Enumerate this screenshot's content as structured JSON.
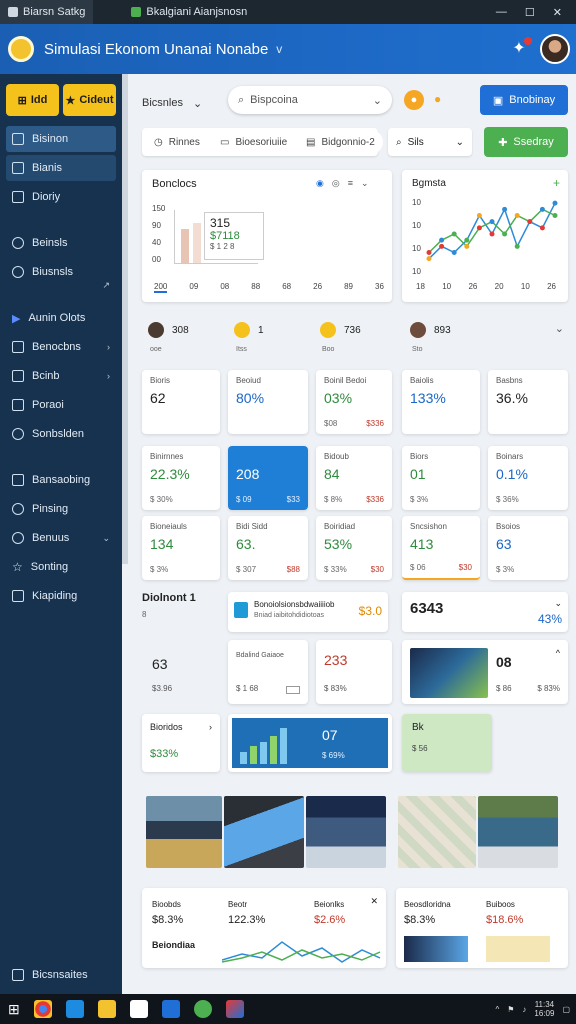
{
  "browser": {
    "tabs": [
      {
        "label": "Biarsn Satkg"
      },
      {
        "label": "Bkalgiani Aianjsnosn"
      }
    ],
    "controls": {
      "min": "—",
      "max": "☐",
      "close": "✕"
    }
  },
  "appbar": {
    "title": "Simulasi Ekonom Unanai Nonabe",
    "chevron": "v"
  },
  "sidebar": {
    "buttons": [
      {
        "label": "Idd"
      },
      {
        "label": "Cideut"
      }
    ],
    "items": [
      {
        "label": "Bisinon"
      },
      {
        "label": "Bianis"
      },
      {
        "label": "Dioriy"
      },
      {
        "label": "Beinsls"
      },
      {
        "label": "Biusnsls"
      },
      {
        "label": "Aunin Olots"
      },
      {
        "label": "Benocbns"
      },
      {
        "label": "Bcinb"
      },
      {
        "label": "Poraoi"
      },
      {
        "label": "Sonbslden"
      },
      {
        "label": "Bansaobing"
      },
      {
        "label": "Pinsing"
      },
      {
        "label": "Benuus"
      },
      {
        "label": "Sonting"
      },
      {
        "label": "Kiapiding"
      }
    ],
    "bottom": "Bicsnsaites"
  },
  "toolbar": {
    "dropdown": "Bicsnles",
    "search_value": "Bispcoina",
    "action_button": "Bnobinay",
    "filters": [
      {
        "label": "Rinnes"
      },
      {
        "label": "Bioesoriuiie"
      },
      {
        "label": "Bidgonnio-2"
      }
    ],
    "search2": "Sils",
    "action_button2": "Ssedray"
  },
  "chart1": {
    "title": "Bonclocs",
    "yticks": [
      "150",
      "90",
      "40",
      "00"
    ],
    "xticks": [
      "200",
      "09",
      "08",
      "88",
      "68",
      "26",
      "89",
      "36"
    ],
    "values": {
      "big": "315",
      "mid": "$7118",
      "sub": "$ 1 2 8"
    }
  },
  "chart2": {
    "title": "Bgmsta",
    "yticks": [
      "10",
      "10",
      "10",
      "10"
    ],
    "xticks": [
      "18",
      "10",
      "26",
      "20",
      "10",
      "26"
    ]
  },
  "chart_data": {
    "type": "line",
    "x": [
      "18",
      "10",
      "26",
      "20",
      "10",
      "26"
    ],
    "series": [
      {
        "values": [
          2,
          4,
          3,
          5,
          9,
          6,
          10,
          4,
          8,
          7,
          11
        ]
      },
      {
        "values": [
          3,
          5,
          6,
          4,
          7,
          8,
          6,
          9,
          8,
          10,
          9
        ]
      }
    ],
    "title": "Bgmsta"
  },
  "players": [
    {
      "label": "308",
      "sub": "ooe"
    },
    {
      "label": "1",
      "sub": "Itss"
    },
    {
      "label": "736",
      "sub": "Boo"
    },
    {
      "label": "893",
      "sub": "Sto"
    }
  ],
  "kpis": [
    {
      "label": "Bioris",
      "value": "62",
      "sub": "",
      "sub2": ""
    },
    {
      "label": "Beoiud",
      "value": "80%",
      "sub": "",
      "sub2": ""
    },
    {
      "label": "Boinil Bedoi",
      "value": "03%",
      "sub": "$08",
      "sub2": "$336"
    },
    {
      "label": "Baiolis",
      "value": "133%",
      "sub": "",
      "sub2": ""
    },
    {
      "label": "Basbns",
      "value": "36.%",
      "sub": "",
      "sub2": ""
    },
    {
      "label": "Binirnnes",
      "value": "22.3%",
      "sub": "$ 30%",
      "sub2": ""
    },
    {
      "label": "",
      "value": "208",
      "sub": "$ 09",
      "sub2": "$33"
    },
    {
      "label": "Bidoub",
      "value": "84",
      "sub": "$ 8%",
      "sub2": "$336"
    },
    {
      "label": "Biors",
      "value": "01",
      "sub": "$ 3%",
      "sub2": ""
    },
    {
      "label": "Boinars",
      "value": "0.1%",
      "sub": "$ 36%",
      "sub2": ""
    },
    {
      "label": "Bioneiauls",
      "value": "134",
      "sub": "$ 3%",
      "sub2": ""
    },
    {
      "label": "Bidi Sidd",
      "value": "63.",
      "sub": "$ 307",
      "sub2": "$88"
    },
    {
      "label": "Boiridiad",
      "value": "53%",
      "sub": "$ 33%",
      "sub2": "$30"
    },
    {
      "label": "Sncsishon",
      "value": "413",
      "sub": "$ 06",
      "sub2": "$30"
    },
    {
      "label": "Bsoios",
      "value": "63",
      "sub": "$ 3%",
      "sub2": ""
    }
  ],
  "summary": {
    "box1_title": "Diolnont 1",
    "box1_sub": "8",
    "box2_title": "Bonoiolsionsbdwaiiiiob",
    "box2_sub": "Bniad iaibitohdidiotoas",
    "box2_value": "$3.0",
    "box3_value": "6343",
    "box3_pct": "43%",
    "row2": [
      {
        "value": "63",
        "sub": "$3.96"
      },
      {
        "label": "Bdalind Gaiaoe",
        "sub": "$ 1 68"
      },
      {
        "value": "233",
        "sub": "$ 83%"
      },
      {
        "value": "08",
        "sub": "$ 86",
        "sub2": "$ 83%"
      }
    ],
    "row3": [
      {
        "label": "Bioridos",
        "value": "$33%"
      },
      {
        "value": "07",
        "sub": "$ 69%"
      },
      {
        "label": "Bk",
        "sub": "$ 56"
      }
    ]
  },
  "bottom_cards": [
    {
      "a": "Bioobds",
      "av": "$8.3%",
      "b": "Beotr",
      "bv": "122.3%",
      "c": "Beionlks",
      "cv": "$2.6%",
      "d": "Beiondiaa"
    },
    {
      "a": "Beosdloridna",
      "av": "$8.3%",
      "b": "Buiboos",
      "bv": "$18.6%"
    }
  ],
  "taskbar": {
    "time": "11:34",
    "date": "16:09"
  }
}
